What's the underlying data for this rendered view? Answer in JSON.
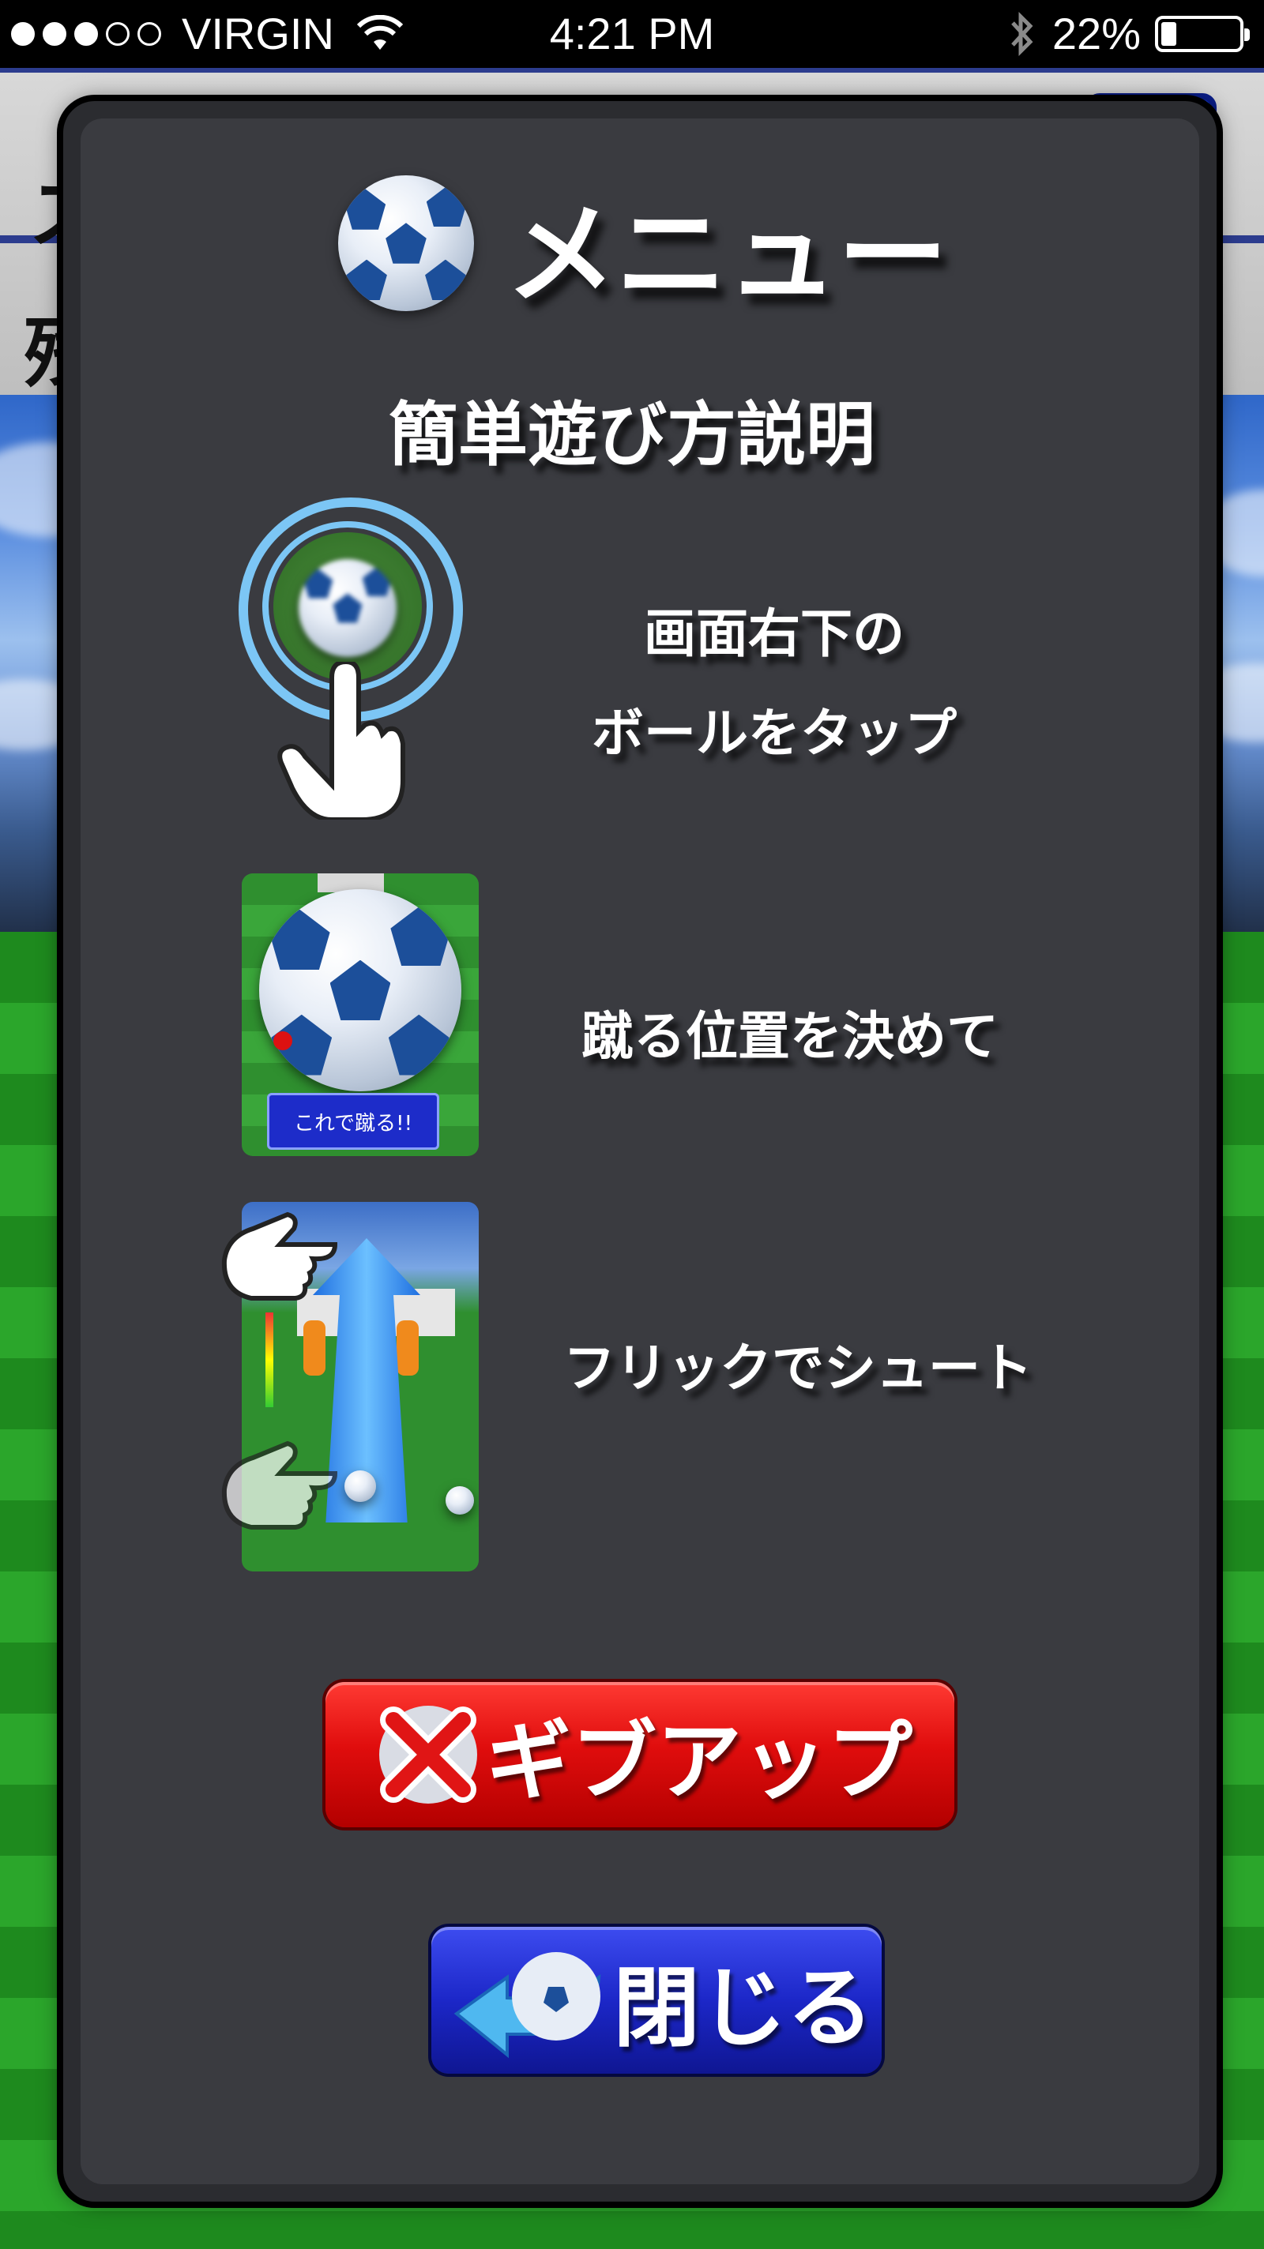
{
  "status_bar": {
    "carrier": "VIRGIN",
    "time": "4:21 PM",
    "battery": "22%",
    "signal_bars_filled": 3,
    "signal_bars_total": 5,
    "battery_level": 0.22
  },
  "menu": {
    "title": "メニュー",
    "subtitle": "簡単遊び方説明",
    "steps": [
      {
        "text_line1": "画面右下の",
        "text_line2": "ボールをタップ"
      },
      {
        "text": "蹴る位置を決めて",
        "thumb_button": "これで蹴る!!"
      },
      {
        "text": "フリックでシュート"
      }
    ],
    "buttons": {
      "giveup_label": "ギブアップ",
      "close_label": "閉じる"
    }
  },
  "colors": {
    "panel": "#3a3b40",
    "giveup": "#e00d0d",
    "close": "#1c27c8"
  }
}
